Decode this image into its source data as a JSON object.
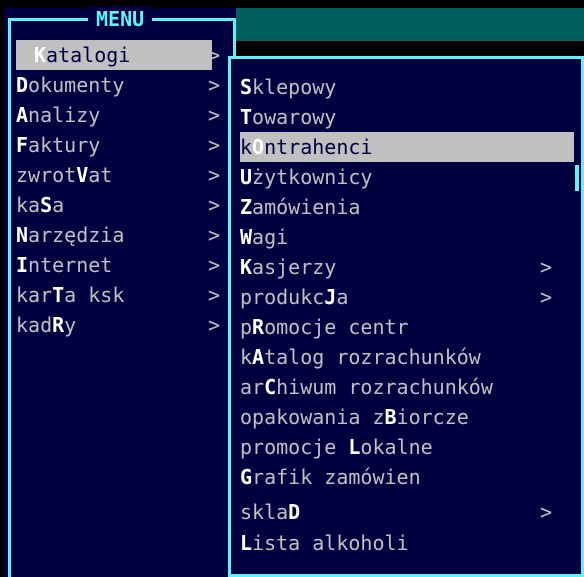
{
  "menu": {
    "title": "MENU",
    "items": [
      {
        "pre": "",
        "hk": "K",
        "post": "atalogi",
        "arrow": ">",
        "selected": true
      },
      {
        "pre": "",
        "hk": "D",
        "post": "okumenty",
        "arrow": ">",
        "selected": false
      },
      {
        "pre": "",
        "hk": "A",
        "post": "nalizy",
        "arrow": ">",
        "selected": false
      },
      {
        "pre": "",
        "hk": "F",
        "post": "aktury",
        "arrow": ">",
        "selected": false
      },
      {
        "pre": "zwrot",
        "hk": "V",
        "post": "at",
        "arrow": ">",
        "selected": false
      },
      {
        "pre": "ka",
        "hk": "S",
        "post": "a",
        "arrow": ">",
        "selected": false
      },
      {
        "pre": "",
        "hk": "N",
        "post": "arzędzia",
        "arrow": ">",
        "selected": false
      },
      {
        "pre": "",
        "hk": "I",
        "post": "nternet",
        "arrow": ">",
        "selected": false
      },
      {
        "pre": "kar",
        "hk": "T",
        "post": "a ksk",
        "arrow": ">",
        "selected": false
      },
      {
        "pre": "kad",
        "hk": "R",
        "post": "y",
        "arrow": ">",
        "selected": false
      }
    ]
  },
  "submenu": {
    "items": [
      {
        "pre": "",
        "hk": "S",
        "post": "klepowy",
        "arrow": "",
        "selected": false
      },
      {
        "pre": "",
        "hk": "T",
        "post": "owarowy",
        "arrow": "",
        "selected": false
      },
      {
        "pre": "k",
        "hk": "O",
        "post": "ntrahenci",
        "arrow": "",
        "selected": true
      },
      {
        "pre": "",
        "hk": "U",
        "post": "żytkownicy",
        "arrow": "",
        "selected": false
      },
      {
        "pre": "",
        "hk": "Z",
        "post": "amówienia",
        "arrow": "",
        "selected": false
      },
      {
        "pre": "",
        "hk": "W",
        "post": "agi",
        "arrow": "",
        "selected": false
      },
      {
        "pre": "",
        "hk": "K",
        "post": "asjerzy",
        "arrow": ">",
        "selected": false
      },
      {
        "pre": "produkc",
        "hk": "J",
        "post": "a",
        "arrow": ">",
        "selected": false
      },
      {
        "pre": "p",
        "hk": "R",
        "post": "omocje centr",
        "arrow": "",
        "selected": false
      },
      {
        "pre": "k",
        "hk": "A",
        "post": "talog rozrachunków",
        "arrow": "",
        "selected": false
      },
      {
        "pre": "ar",
        "hk": "C",
        "post": "hiwum rozrachunków",
        "arrow": "",
        "selected": false
      },
      {
        "pre": "opakowania z",
        "hk": "B",
        "post": "iorcze",
        "arrow": "",
        "selected": false
      },
      {
        "pre": "promocje ",
        "hk": "L",
        "post": "okalne",
        "arrow": "",
        "selected": false
      },
      {
        "pre": "",
        "hk": "G",
        "post": "rafik zamówien",
        "arrow": "",
        "selected": false
      },
      {
        "pre": "skla",
        "hk": "D",
        "post": "",
        "arrow": ">",
        "selected": false
      },
      {
        "pre": "",
        "hk": "L",
        "post": "ista alkoholi",
        "arrow": "",
        "selected": false
      }
    ]
  },
  "colors": {
    "background": "#000040",
    "frame": "#5ff3f3",
    "text": "#c0c0c0",
    "hotkey": "#ffffff",
    "highlight": "#c0c0c0",
    "header_band": "#005f5f"
  }
}
